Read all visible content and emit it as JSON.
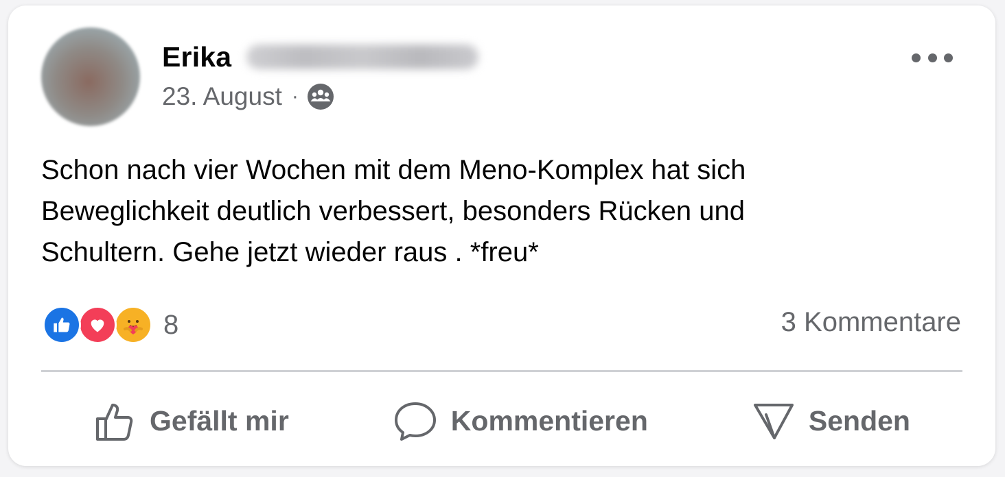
{
  "post": {
    "author_first_name": "Erika",
    "date": "23. August",
    "separator": "·",
    "privacy_icon": "group-icon",
    "text_lines": [
      "Schon nach vier Wochen mit dem Meno-Komplex hat sich",
      "Beweglichkeit deutlich verbessert, besonders Rücken und",
      "Schultern. Gehe jetzt wieder raus  . *freu*"
    ]
  },
  "reactions": {
    "icons": [
      "like-reaction-icon",
      "love-reaction-icon",
      "care-reaction-icon"
    ],
    "count": "8"
  },
  "comments": {
    "label": "3 Kommentare"
  },
  "actions": {
    "like_label": "Gefällt mir",
    "comment_label": "Kommentieren",
    "send_label": "Senden"
  },
  "colors": {
    "like_blue": "#1b74e4",
    "love_red": "#f33e58",
    "care_yellow": "#f7b125",
    "secondary_text": "#65676b",
    "primary_text": "#050505"
  }
}
